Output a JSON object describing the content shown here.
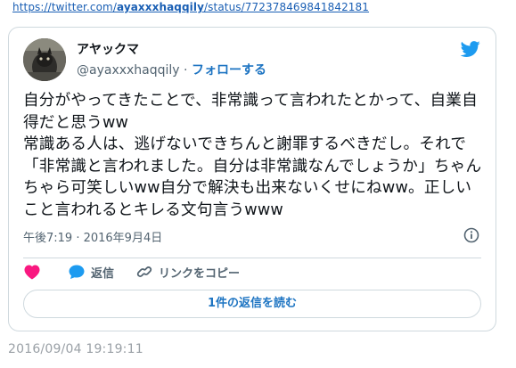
{
  "source_url": {
    "prefix": "https://twitter.com/",
    "user": "ayaxxxhaqqily",
    "suffix": "/status/772378469841842181"
  },
  "tweet": {
    "author_name": "アヤックマ",
    "author_handle": "@ayaxxxhaqqily",
    "separator": " · ",
    "follow_label": "フォローする",
    "text": "自分がやってきたことで、非常識って言われたとかって、自業自得だと思うww\n常識ある人は、逃げないできちんと謝罪するべきだし。それで「非常識と言われました。自分は非常識なんでしょうか」ちゃんちゃら可笑しいww自分で解決も出来ないくせにねww。正しいこと言われるとキレる文句言うwww",
    "timestamp": "午後7:19 · 2016年9月4日",
    "actions": {
      "like_label": "",
      "reply_label": "返信",
      "copy_link_label": "リンクをコピー"
    },
    "read_replies_label": "1件の返信を読む"
  },
  "archived_date": "2016/09/04 19:19:11",
  "colors": {
    "link_blue": "#1d74c2",
    "twitter_blue": "#1d9bf0",
    "like_pink": "#f91880",
    "muted_text": "#536471",
    "border": "#cfd9de"
  },
  "icons": [
    "twitter-bird-icon",
    "info-icon",
    "heart-icon",
    "reply-bubble-icon",
    "link-icon"
  ]
}
